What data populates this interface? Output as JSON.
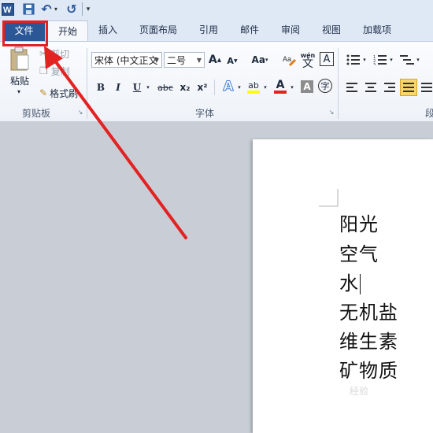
{
  "qat": {
    "app_icon": "word-icon",
    "undo_glyph": "↶",
    "redo_glyph": "↺",
    "customize_glyph": "▾"
  },
  "tabs": [
    {
      "label": "文件"
    },
    {
      "label": "开始"
    },
    {
      "label": "插入"
    },
    {
      "label": "页面布局"
    },
    {
      "label": "引用"
    },
    {
      "label": "邮件"
    },
    {
      "label": "审阅"
    },
    {
      "label": "视图"
    },
    {
      "label": "加载项"
    }
  ],
  "clipboard": {
    "paste": "粘贴",
    "cut": "剪切",
    "copy": "复制",
    "format_painter": "格式刷",
    "group": "剪贴板"
  },
  "font": {
    "name": "宋体 (中文正文",
    "size": "二号",
    "group": "字体",
    "bold": "B",
    "italic": "I",
    "underline": "U",
    "strike": "abc",
    "sub": "x₂",
    "sup": "x²",
    "grow": "A",
    "shrink": "A",
    "case": "Aa",
    "effect": "A",
    "color_a": "A",
    "char_border": "A",
    "enclose": "字",
    "phonetic": "wén",
    "phonetic_char": "文"
  },
  "paragraph": {
    "group": "段"
  },
  "document": {
    "lines": [
      "阳光",
      "空气",
      "水",
      "无机盐",
      "维生素",
      "矿物质"
    ]
  },
  "annotation": {
    "color": "#e32222"
  },
  "watermark": "经验"
}
